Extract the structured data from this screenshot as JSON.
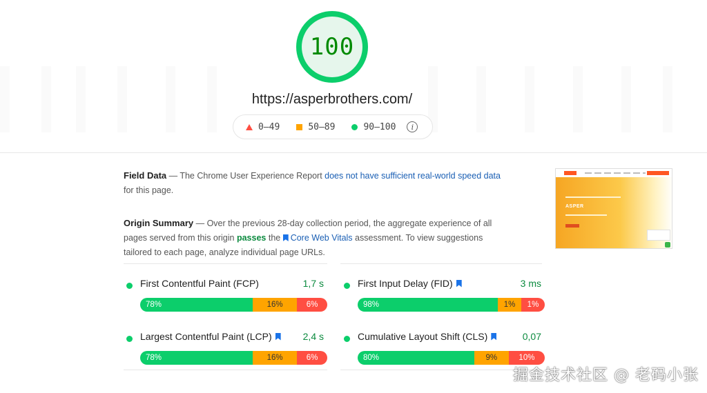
{
  "score": {
    "value": "100"
  },
  "url": "https://asperbrothers.com/",
  "legend": {
    "items": [
      {
        "label": "0–49",
        "shape": "triangle",
        "color": "#ff4e42"
      },
      {
        "label": "50–89",
        "shape": "square",
        "color": "#ffa400"
      },
      {
        "label": "90–100",
        "shape": "circle",
        "color": "#0cce6b"
      }
    ],
    "info_icon": "info-icon"
  },
  "field_data": {
    "heading": "Field Data",
    "text_before": " — The Chrome User Experience Report ",
    "link": "does not have sufficient real-world speed data",
    "text_after": " for this page."
  },
  "origin_summary": {
    "heading": "Origin Summary",
    "text_before": " — Over the previous 28-day collection period, the aggregate experience of all pages served from this origin ",
    "passes": "passes",
    "text_mid": " the ",
    "link": "Core Web Vitals",
    "text_after": " assessment. To view suggestions tailored to each page, analyze individual page URLs."
  },
  "thumbnail": {
    "title": "ASPER"
  },
  "metrics": [
    {
      "name": "First Contentful Paint (FCP)",
      "core": false,
      "value": "1,7 s",
      "good": 78,
      "avg": 16,
      "poor": 6,
      "good_label": "78%",
      "avg_label": "16%",
      "poor_label": "6%"
    },
    {
      "name": "First Input Delay (FID)",
      "core": true,
      "value": "3 ms",
      "good": 98,
      "avg": 1,
      "poor": 1,
      "good_label": "98%",
      "avg_label": "1%",
      "poor_label": "1%"
    },
    {
      "name": "Largest Contentful Paint (LCP)",
      "core": true,
      "value": "2,4 s",
      "good": 78,
      "avg": 16,
      "poor": 6,
      "good_label": "78%",
      "avg_label": "16%",
      "poor_label": "6%"
    },
    {
      "name": "Cumulative Layout Shift (CLS)",
      "core": true,
      "value": "0,07",
      "good": 80,
      "avg": 9,
      "poor": 10,
      "good_label": "80%",
      "avg_label": "9%",
      "poor_label": "10%"
    }
  ],
  "colors": {
    "good": "#0cce6b",
    "average": "#ffa400",
    "poor": "#ff4e42",
    "link": "#1a5fb4"
  },
  "watermark": "掘金技术社区 @ 老码小张"
}
